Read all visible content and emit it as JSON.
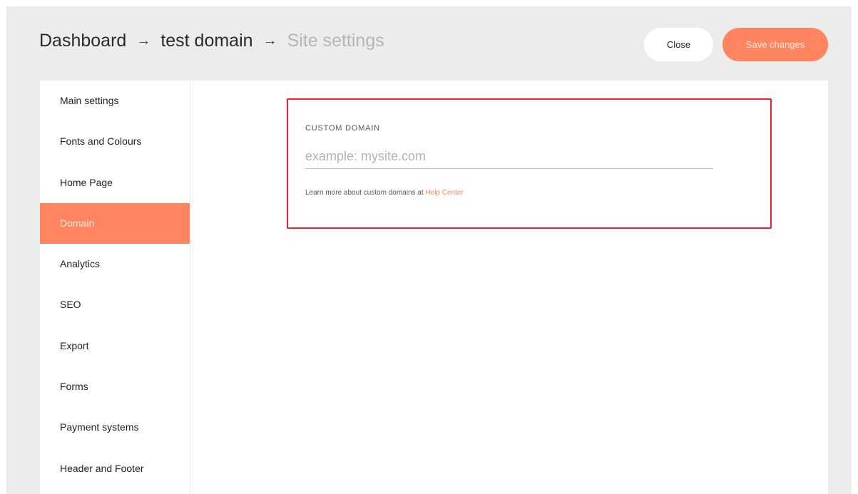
{
  "header": {
    "breadcrumb": {
      "items": [
        "Dashboard",
        "test domain"
      ],
      "current": "Site settings",
      "separator": "→"
    },
    "close_label": "Close",
    "save_label": "Save changes"
  },
  "sidebar": {
    "items": [
      {
        "label": "Main settings"
      },
      {
        "label": "Fonts and Colours"
      },
      {
        "label": "Home Page"
      },
      {
        "label": "Domain",
        "active": true
      },
      {
        "label": "Analytics"
      },
      {
        "label": "SEO"
      },
      {
        "label": "Export"
      },
      {
        "label": "Forms"
      },
      {
        "label": "Payment systems"
      },
      {
        "label": "Header and Footer"
      }
    ]
  },
  "domain": {
    "label": "CUSTOM DOMAIN",
    "placeholder": "example: mysite.com",
    "value": "",
    "help_prefix": "Learn more about custom domains at ",
    "help_link": "Help Center"
  },
  "colors": {
    "accent": "#ff8460",
    "highlight_border": "#e8232a",
    "background": "#ececec"
  }
}
